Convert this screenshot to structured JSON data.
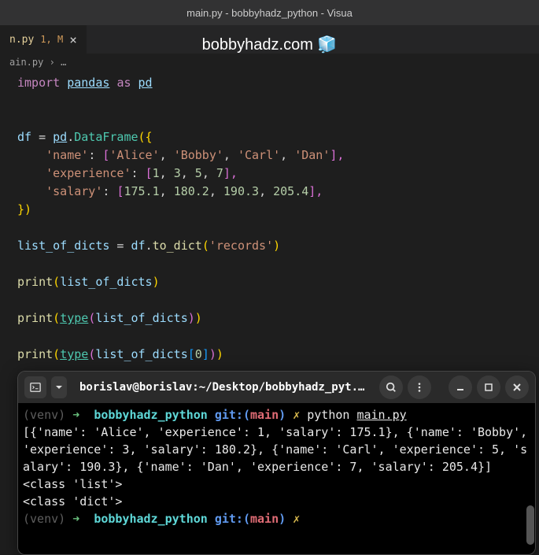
{
  "window": {
    "title": "main.py - bobbyhadz_python - Visua",
    "watermark": "bobbyhadz.com 🧊"
  },
  "tab": {
    "name": "n.py",
    "status": "1, M",
    "close": "×"
  },
  "breadcrumb": {
    "file": "ain.py",
    "sep": "›",
    "more": "…"
  },
  "code": {
    "l1": {
      "import": "import",
      "pandas": "pandas",
      "as": "as",
      "pd": "pd"
    },
    "l3": {
      "df": "df",
      "eq": "=",
      "pd": "pd",
      "dot": ".",
      "DataFrame": "DataFrame",
      "open": "({"
    },
    "l4": {
      "key": "'name'",
      "colon": ": ",
      "open": "[",
      "v1": "'Alice'",
      "c": ", ",
      "v2": "'Bobby'",
      "v3": "'Carl'",
      "v4": "'Dan'",
      "close": "],"
    },
    "l5": {
      "key": "'experience'",
      "colon": ": ",
      "open": "[",
      "v1": "1",
      "c": ", ",
      "v2": "3",
      "v3": "5",
      "v4": "7",
      "close": "],"
    },
    "l6": {
      "key": "'salary'",
      "colon": ": ",
      "open": "[",
      "v1": "175.1",
      "c": ", ",
      "v2": "180.2",
      "v3": "190.3",
      "v4": "205.4",
      "close": "],"
    },
    "l7": {
      "close": "})"
    },
    "l9": {
      "var": "list_of_dicts",
      "eq": " = ",
      "df": "df",
      "dot": ".",
      "method": "to_dict",
      "open": "(",
      "arg": "'records'",
      "close": ")"
    },
    "l11": {
      "print": "print",
      "open": "(",
      "arg": "list_of_dicts",
      "close": ")"
    },
    "l13": {
      "print": "print",
      "open": "(",
      "type": "type",
      "open2": "(",
      "arg": "list_of_dicts",
      "close2": ")",
      "close": ")"
    },
    "l15": {
      "print": "print",
      "open": "(",
      "type": "type",
      "open2": "(",
      "arg": "list_of_dicts",
      "open3": "[",
      "idx": "0",
      "close3": "]",
      "close2": ")",
      "close": ")"
    }
  },
  "terminal": {
    "title": "borislav@borislav:~/Desktop/bobbyhadz_pyt...",
    "prompt": {
      "venv": "(venv)",
      "arrow": "➜",
      "dir": "bobbyhadz_python",
      "git": "git:(",
      "branch": "main",
      "gitClose": ")",
      "dirty": "✗",
      "cmd_python": "python",
      "cmd_file": "main.py"
    },
    "output": {
      "l1": "[{'name': 'Alice', 'experience': 1, 'salary': 175.1}, {'name': 'Bobby', 'experience': 3, 'salary': 180.2}, {'name': 'Carl', 'experience': 5, 'salary': 190.3}, {'name': 'Dan', 'experience': 7, 'salary': 205.4}]",
      "l2": "<class 'list'>",
      "l3": "<class 'dict'>"
    }
  }
}
